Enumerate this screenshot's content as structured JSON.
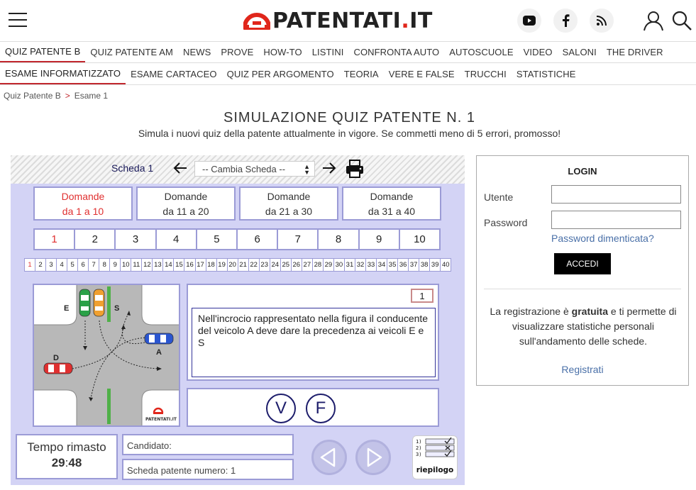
{
  "header": {
    "logo_text": "PATENTATI",
    "logo_tld": ".IT",
    "icons": [
      "menu-icon",
      "youtube-icon",
      "facebook-icon",
      "rss-icon",
      "user-icon",
      "search-icon"
    ]
  },
  "nav_primary": [
    {
      "label": "QUIZ PATENTE B",
      "active": true
    },
    {
      "label": "QUIZ PATENTE AM"
    },
    {
      "label": "NEWS"
    },
    {
      "label": "PROVE"
    },
    {
      "label": "HOW-TO"
    },
    {
      "label": "LISTINI"
    },
    {
      "label": "CONFRONTA AUTO"
    },
    {
      "label": "AUTOSCUOLE"
    },
    {
      "label": "VIDEO"
    },
    {
      "label": "SALONI"
    },
    {
      "label": "THE DRIVER"
    }
  ],
  "nav_secondary": [
    {
      "label": "ESAME INFORMATIZZATO",
      "active": true
    },
    {
      "label": "ESAME CARTACEO"
    },
    {
      "label": "QUIZ PER ARGOMENTO"
    },
    {
      "label": "TEORIA"
    },
    {
      "label": "VERE E FALSE"
    },
    {
      "label": "TRUCCHI"
    },
    {
      "label": "STATISTICHE"
    }
  ],
  "breadcrumb": {
    "items": [
      "Quiz Patente B",
      "Esame 1"
    ],
    "separator": ">"
  },
  "page": {
    "title": "SIMULAZIONE QUIZ PATENTE N. 1",
    "subtitle": "Simula i nuovi quiz della patente attualmente in vigore. Se commetti meno di 5 errori, promosso!"
  },
  "quiz": {
    "scheda_label": "Scheda 1",
    "select_value": "-- Cambia Scheda --",
    "groups": [
      {
        "line1": "Domande",
        "line2": "da 1 a 10",
        "active": true
      },
      {
        "line1": "Domande",
        "line2": "da 11 a 20"
      },
      {
        "line1": "Domande",
        "line2": "da 21 a 30"
      },
      {
        "line1": "Domande",
        "line2": "da 31 a 40"
      }
    ],
    "question_row": [
      "1",
      "2",
      "3",
      "4",
      "5",
      "6",
      "7",
      "8",
      "9",
      "10"
    ],
    "small_row": [
      "1",
      "2",
      "3",
      "4",
      "5",
      "6",
      "7",
      "8",
      "9",
      "10",
      "11",
      "12",
      "13",
      "14",
      "15",
      "16",
      "17",
      "18",
      "19",
      "20",
      "21",
      "22",
      "23",
      "24",
      "25",
      "26",
      "27",
      "28",
      "29",
      "30",
      "31",
      "32",
      "33",
      "34",
      "35",
      "36",
      "37",
      "38",
      "39",
      "40"
    ],
    "active_question": "1",
    "question_number": "1",
    "question_text": "Nell'incrocio rappresentato nella figura il conducente del veicolo A deve dare la precedenza ai veicoli E e S",
    "figure_labels": {
      "e": "E",
      "s": "S",
      "a": "A",
      "d": "D",
      "watermark": "PATENTATI.IT"
    },
    "answer_true": "V",
    "answer_false": "F",
    "timer_label": "Tempo rimasto",
    "timer_minutes": "29",
    "timer_sep": ":",
    "timer_seconds": "48",
    "candidate_label": "Candidato:",
    "scheda_field": "Scheda patente numero: 1",
    "riepilogo_label": "riepilogo",
    "riepilogo_rows": [
      "1)",
      "2)",
      "3)"
    ]
  },
  "login": {
    "title": "LOGIN",
    "user_label": "Utente",
    "password_label": "Password",
    "forgot": "Password dimenticata?",
    "submit": "ACCEDI",
    "reg_pre": "La registrazione è ",
    "reg_bold": "gratuita",
    "reg_post": " e ti permette di visualizzare statistiche personali sull'andamento delle schede.",
    "register_link": "Registrati"
  },
  "colors": {
    "accent": "#c1272d",
    "quiz_bg": "#d3d3f5",
    "box_border": "#9b9bd6",
    "dark_blue": "#1d1d6b",
    "link": "#4a70a8"
  }
}
